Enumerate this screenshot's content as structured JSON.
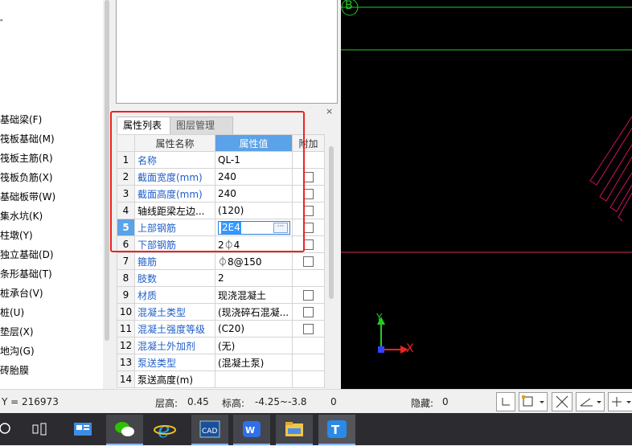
{
  "tree": {
    "items": [
      "基础梁(F)",
      "筏板基础(M)",
      "筏板主筋(R)",
      "筏板负筋(X)",
      "基础板带(W)",
      "集水坑(K)",
      "柱墩(Y)",
      "独立基础(D)",
      "条形基础(T)",
      "桩承台(V)",
      "桩(U)",
      "垫层(X)",
      "地沟(G)",
      "砖胎膜"
    ],
    "partial_top": "ﾞ"
  },
  "panel": {
    "close_icon": "×",
    "tabs": [
      {
        "label": "属性列表"
      },
      {
        "label": "图层管理"
      }
    ],
    "headers": {
      "name": "属性名称",
      "value": "属性值",
      "extra": "附加"
    },
    "rows": [
      {
        "num": "1",
        "name": "名称",
        "value": "QL-1",
        "blue": true,
        "check": false
      },
      {
        "num": "2",
        "name": "截面宽度(mm)",
        "value": "240",
        "blue": true,
        "check": true
      },
      {
        "num": "3",
        "name": "截面高度(mm)",
        "value": "240",
        "blue": true,
        "check": true
      },
      {
        "num": "4",
        "name": "轴线距梁左边...",
        "value": "(120)",
        "blue": false,
        "check": true
      },
      {
        "num": "5",
        "name": "上部钢筋",
        "value": "2E4",
        "blue": true,
        "check": true,
        "editing": true
      },
      {
        "num": "6",
        "name": "下部钢筋",
        "value": "2⏀4",
        "blue": true,
        "check": true
      },
      {
        "num": "7",
        "name": "箍筋",
        "value": "⏀8@150",
        "blue": true,
        "check": true
      },
      {
        "num": "8",
        "name": "肢数",
        "value": "2",
        "blue": true,
        "check": false
      },
      {
        "num": "9",
        "name": "材质",
        "value": "现浇混凝土",
        "blue": true,
        "check": true
      },
      {
        "num": "10",
        "name": "混凝土类型",
        "value": "(现浇碎石混凝...",
        "blue": true,
        "check": true
      },
      {
        "num": "11",
        "name": "混凝土强度等级",
        "value": "(C20)",
        "blue": true,
        "check": true
      },
      {
        "num": "12",
        "name": "混凝土外加剂",
        "value": "(无)",
        "blue": true,
        "check": false
      },
      {
        "num": "13",
        "name": "泵送类型",
        "value": "(混凝土泵)",
        "blue": true,
        "check": false
      },
      {
        "num": "14",
        "name": "泵送高度(m)",
        "value": "",
        "blue": false,
        "check": false
      }
    ]
  },
  "canvas": {
    "axis_label": "B",
    "y_label": "Y",
    "x_label": "X"
  },
  "status": {
    "coord": "Y = 216973",
    "floor_height_label": "层高:",
    "floor_height": "0.45",
    "elevation_label": "标高:",
    "elevation": "-4.25~-3.8",
    "zero": "0",
    "hidden_label": "隐藏:",
    "hidden": "0"
  },
  "taskbar": {
    "apps": [
      "search-icon",
      "task-view-icon",
      "news-icon",
      "wechat-icon",
      "ie-icon",
      "cad-icon",
      "wps-icon",
      "folder-icon",
      "glodon-icon"
    ]
  }
}
